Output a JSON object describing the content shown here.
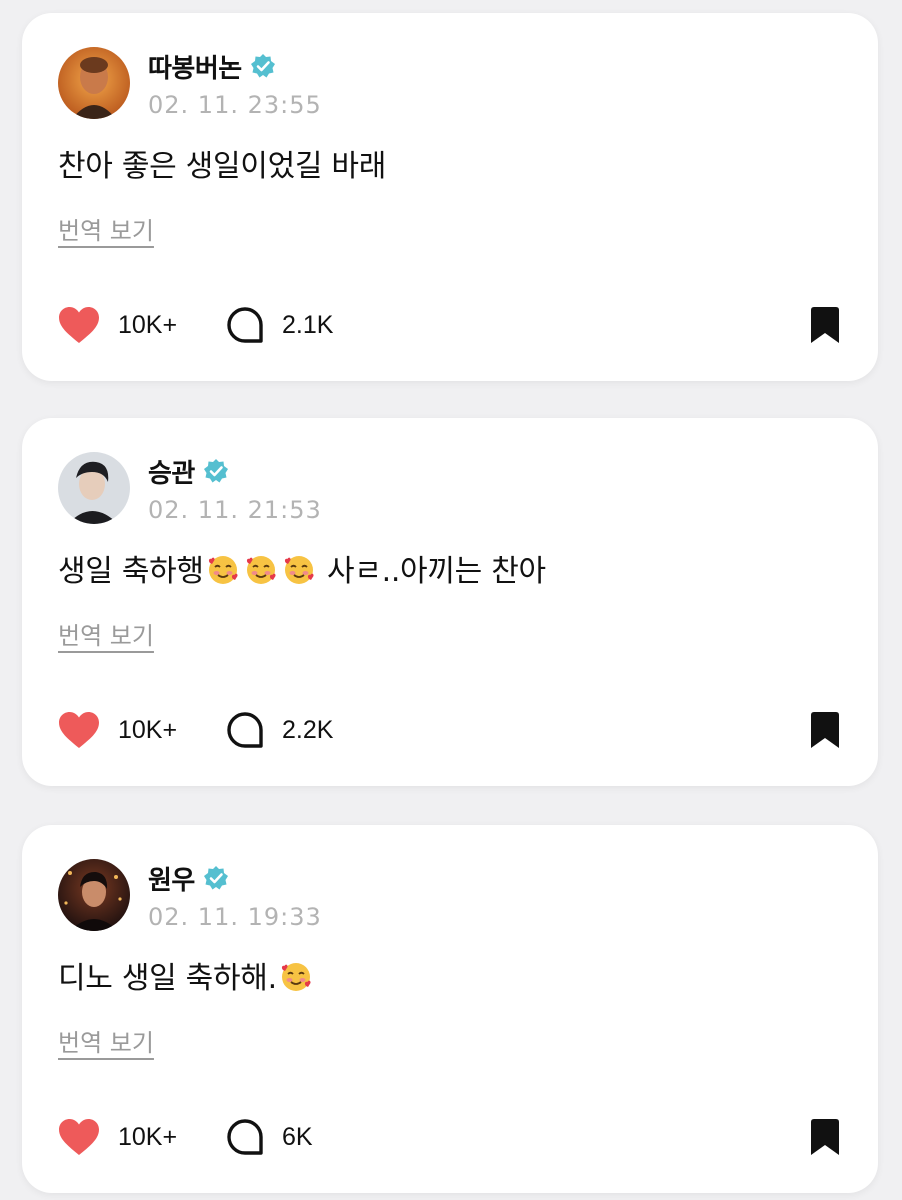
{
  "colors": {
    "background": "#f0f0f2",
    "card": "#ffffff",
    "heart": "#ee5a5a",
    "verified": "#55bfd0",
    "muted": "#b3b3b3"
  },
  "posts": [
    {
      "author": "따봉버논",
      "verified": true,
      "time": "02. 11. 23:55",
      "text": "찬아 좋은 생일이었길 바래",
      "translate_label": "번역 보기",
      "likes": "10K+",
      "comments": "2.1K"
    },
    {
      "author": "승관",
      "verified": true,
      "time": "02. 11. 21:53",
      "text_before": "생일 축하행",
      "emoji": "smiling-face-with-hearts",
      "text_after": " 사ㄹ..아끼는 찬아",
      "translate_label": "번역 보기",
      "likes": "10K+",
      "comments": "2.2K"
    },
    {
      "author": "원우",
      "verified": true,
      "time": "02. 11. 19:33",
      "text_before": "디노 생일 축하해.",
      "emoji": "smiling-face-with-hearts",
      "translate_label": "번역 보기",
      "likes": "10K+",
      "comments": "6K"
    }
  ]
}
